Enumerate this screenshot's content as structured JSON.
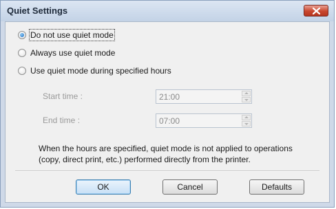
{
  "window": {
    "title": "Quiet Settings",
    "close_icon": "close-icon"
  },
  "options": [
    {
      "label": "Do not use quiet mode",
      "checked": true
    },
    {
      "label": "Always use quiet mode",
      "checked": false
    },
    {
      "label": "Use quiet mode during specified hours",
      "checked": false
    }
  ],
  "start_time": {
    "label": "Start time :",
    "value": "21:00"
  },
  "end_time": {
    "label": "End time :",
    "value": "07:00"
  },
  "note": "When the hours are specified, quiet mode is not applied to operations (copy, direct print, etc.) performed directly from the printer.",
  "buttons": {
    "ok": "OK",
    "cancel": "Cancel",
    "defaults": "Defaults"
  },
  "colors": {
    "close_button": "#c9462e",
    "accent": "#1c6fc2"
  }
}
